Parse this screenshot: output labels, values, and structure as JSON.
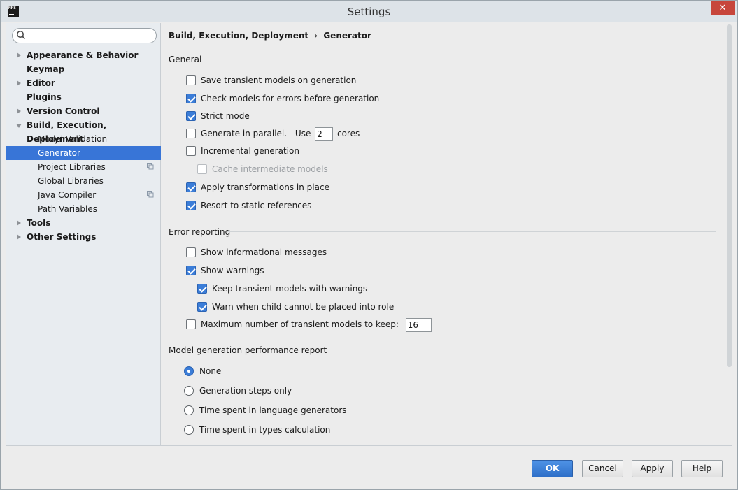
{
  "window": {
    "title": "Settings",
    "app_icon_text": "MPS",
    "close_glyph": "✕"
  },
  "sidebar": {
    "search": {
      "value": "",
      "placeholder": ""
    },
    "items": [
      {
        "label": "Appearance & Behavior",
        "expanded": false
      },
      {
        "label": "Keymap"
      },
      {
        "label": "Editor",
        "expanded": false
      },
      {
        "label": "Plugins"
      },
      {
        "label": "Version Control",
        "expanded": false
      },
      {
        "label": "Build, Execution, Deployment",
        "expanded": true
      },
      {
        "label": "Model Validation"
      },
      {
        "label": "Generator",
        "selected": true
      },
      {
        "label": "Project Libraries",
        "icon": "copy-icon"
      },
      {
        "label": "Global Libraries"
      },
      {
        "label": "Java Compiler",
        "icon": "copy-icon"
      },
      {
        "label": "Path Variables"
      },
      {
        "label": "Tools",
        "expanded": false
      },
      {
        "label": "Other Settings",
        "expanded": false
      }
    ]
  },
  "breadcrumb": {
    "parent": "Build, Execution, Deployment",
    "separator": "›",
    "current": "Generator"
  },
  "general": {
    "title": "General",
    "save_transient": {
      "label": "Save transient models on generation",
      "checked": false
    },
    "check_errors": {
      "label": "Check models for errors before generation",
      "checked": true
    },
    "strict_mode": {
      "label": "Strict mode",
      "checked": true
    },
    "parallel": {
      "label": "Generate in parallel.",
      "use_label": "Use",
      "cores_value": "2",
      "cores_label": "cores",
      "checked": false
    },
    "incremental": {
      "label": "Incremental generation",
      "checked": false
    },
    "cache_intermediate": {
      "label": "Cache intermediate models",
      "checked": false,
      "disabled": true
    },
    "apply_in_place": {
      "label": "Apply transformations in place",
      "checked": true
    },
    "static_refs": {
      "label": "Resort to static references",
      "checked": true
    }
  },
  "error_reporting": {
    "title": "Error reporting",
    "info_messages": {
      "label": "Show informational messages",
      "checked": false
    },
    "warnings": {
      "label": "Show warnings",
      "checked": true
    },
    "keep_transient": {
      "label": "Keep transient models with warnings",
      "checked": true
    },
    "warn_child": {
      "label": "Warn when child cannot be placed into role",
      "checked": true
    },
    "max_transient": {
      "label": "Maximum number of transient models to keep:",
      "value": "16",
      "checked": false
    }
  },
  "perf_report": {
    "title": "Model generation performance report",
    "options": [
      {
        "label": "None",
        "selected": true
      },
      {
        "label": "Generation steps only",
        "selected": false
      },
      {
        "label": "Time spent in language generators",
        "selected": false
      },
      {
        "label": "Time spent in types calculation",
        "selected": false
      }
    ]
  },
  "buttons": {
    "ok": "OK",
    "cancel": "Cancel",
    "apply": "Apply",
    "help": "Help"
  },
  "colors": {
    "accent": "#3875d7",
    "close": "#c7463b"
  }
}
